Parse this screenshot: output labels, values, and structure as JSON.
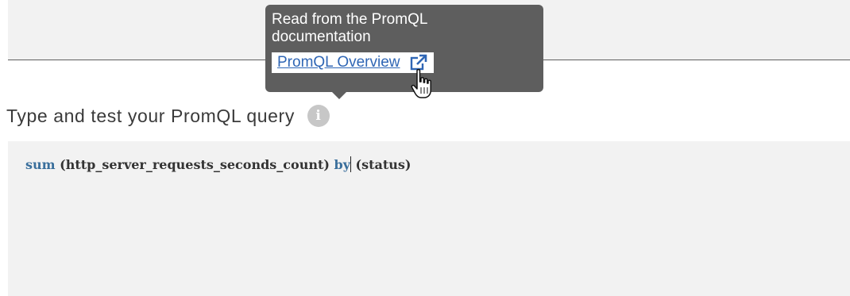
{
  "tooltip": {
    "text": "Read from the PromQL documentation",
    "link_label": "PromQL Overview",
    "link_icon": "external-link-icon"
  },
  "heading": {
    "label": "Type and test your PromQL query",
    "info_icon": "info-icon",
    "info_glyph": "i"
  },
  "editor": {
    "segments": {
      "fn": "sum",
      "args": " (http_server_requests_seconds_count) ",
      "kw_by": "by",
      "group": " (status)"
    }
  },
  "cursor": "hand-pointer-icon",
  "colors": {
    "keyword": "#3a6f9c",
    "link": "#2f66b5",
    "tooltip_bg": "#5e5e5e",
    "editor_bg": "#f2f2f2"
  }
}
